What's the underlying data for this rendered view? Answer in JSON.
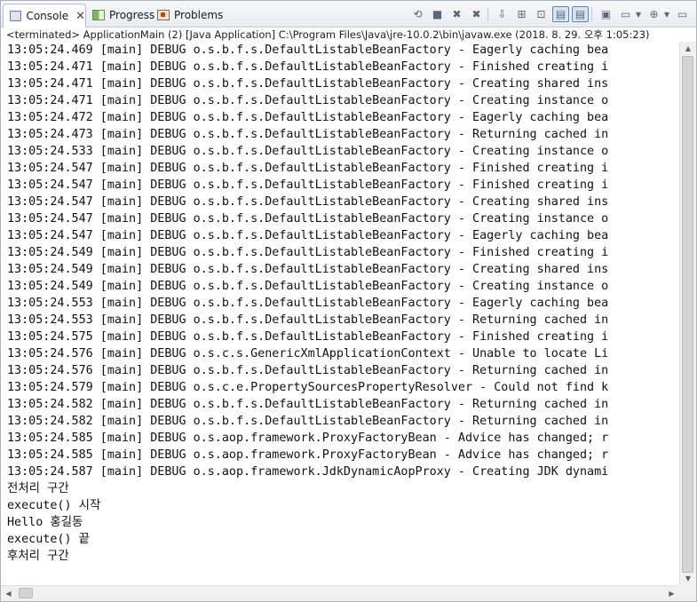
{
  "tabs": [
    {
      "label": "Console",
      "icon": "console-icon",
      "active": true
    },
    {
      "label": "Progress",
      "icon": "progress-icon",
      "active": false
    },
    {
      "label": "Problems",
      "icon": "problems-icon",
      "active": false
    }
  ],
  "toolbar": {
    "icons": [
      "link-icon",
      "terminate-icon",
      "remove-launch-icon",
      "remove-all-icon",
      "scroll-lock-icon",
      "word-wrap-icon",
      "pin-icon",
      "show-stdout-icon",
      "show-stderr-icon",
      "open-console-icon",
      "display-console-icon",
      "new-console-icon",
      "minimize-icon"
    ]
  },
  "description": "<terminated> ApplicationMain (2) [Java Application] C:\\Program Files\\Java\\jre-10.0.2\\bin\\javaw.exe (2018. 8. 29. 오후 1:05:23)",
  "console_lines": [
    "13:05:24.469 [main] DEBUG o.s.b.f.s.DefaultListableBeanFactory - Eagerly caching bea",
    "13:05:24.471 [main] DEBUG o.s.b.f.s.DefaultListableBeanFactory - Finished creating i",
    "13:05:24.471 [main] DEBUG o.s.b.f.s.DefaultListableBeanFactory - Creating shared ins",
    "13:05:24.471 [main] DEBUG o.s.b.f.s.DefaultListableBeanFactory - Creating instance o",
    "13:05:24.472 [main] DEBUG o.s.b.f.s.DefaultListableBeanFactory - Eagerly caching bea",
    "13:05:24.473 [main] DEBUG o.s.b.f.s.DefaultListableBeanFactory - Returning cached in",
    "13:05:24.533 [main] DEBUG o.s.b.f.s.DefaultListableBeanFactory - Creating instance o",
    "13:05:24.547 [main] DEBUG o.s.b.f.s.DefaultListableBeanFactory - Finished creating i",
    "13:05:24.547 [main] DEBUG o.s.b.f.s.DefaultListableBeanFactory - Finished creating i",
    "13:05:24.547 [main] DEBUG o.s.b.f.s.DefaultListableBeanFactory - Creating shared ins",
    "13:05:24.547 [main] DEBUG o.s.b.f.s.DefaultListableBeanFactory - Creating instance o",
    "13:05:24.547 [main] DEBUG o.s.b.f.s.DefaultListableBeanFactory - Eagerly caching bea",
    "13:05:24.549 [main] DEBUG o.s.b.f.s.DefaultListableBeanFactory - Finished creating i",
    "13:05:24.549 [main] DEBUG o.s.b.f.s.DefaultListableBeanFactory - Creating shared ins",
    "13:05:24.549 [main] DEBUG o.s.b.f.s.DefaultListableBeanFactory - Creating instance o",
    "13:05:24.553 [main] DEBUG o.s.b.f.s.DefaultListableBeanFactory - Eagerly caching bea",
    "13:05:24.553 [main] DEBUG o.s.b.f.s.DefaultListableBeanFactory - Returning cached in",
    "13:05:24.575 [main] DEBUG o.s.b.f.s.DefaultListableBeanFactory - Finished creating i",
    "13:05:24.576 [main] DEBUG o.s.c.s.GenericXmlApplicationContext - Unable to locate Li",
    "13:05:24.576 [main] DEBUG o.s.b.f.s.DefaultListableBeanFactory - Returning cached in",
    "13:05:24.579 [main] DEBUG o.s.c.e.PropertySourcesPropertyResolver - Could not find k",
    "13:05:24.582 [main] DEBUG o.s.b.f.s.DefaultListableBeanFactory - Returning cached in",
    "13:05:24.582 [main] DEBUG o.s.b.f.s.DefaultListableBeanFactory - Returning cached in",
    "13:05:24.585 [main] DEBUG o.s.aop.framework.ProxyFactoryBean - Advice has changed; r",
    "13:05:24.585 [main] DEBUG o.s.aop.framework.ProxyFactoryBean - Advice has changed; r",
    "13:05:24.587 [main] DEBUG o.s.aop.framework.JdkDynamicAopProxy - Creating JDK dynami",
    "전처리 구간",
    "execute() 시작",
    "Hello 홍길동",
    "execute() 끝",
    "후처리 구간"
  ]
}
